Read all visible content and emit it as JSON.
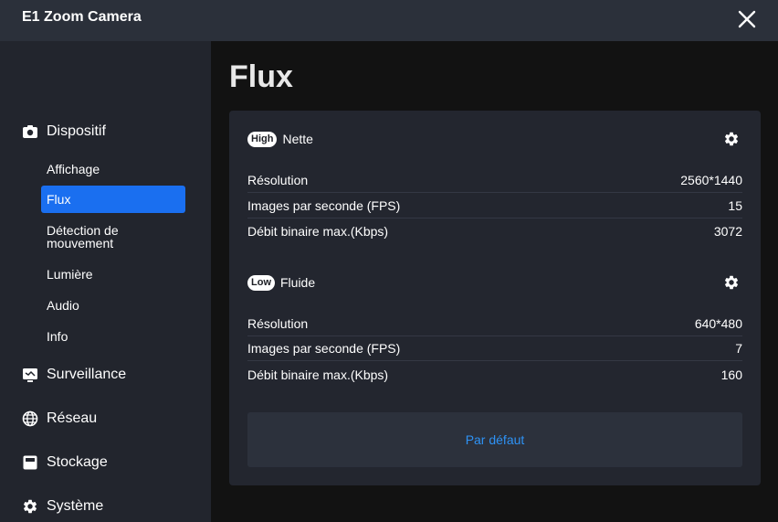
{
  "window": {
    "title": "E1 Zoom Camera"
  },
  "sidebar": {
    "sections": {
      "device": "Dispositif",
      "surveillance": "Surveillance",
      "network": "Réseau",
      "storage": "Stockage",
      "system": "Système"
    },
    "device_items": [
      "Affichage",
      "Flux",
      "Détection de mouvement",
      "Lumière",
      "Audio",
      "Info"
    ],
    "active_item": "Flux"
  },
  "page": {
    "title": "Flux"
  },
  "streams": [
    {
      "badge": "High",
      "name": "Nette",
      "rows": [
        {
          "label": "Résolution",
          "value": "2560*1440"
        },
        {
          "label": "Images par seconde (FPS)",
          "value": "15"
        },
        {
          "label": "Débit binaire max.(Kbps)",
          "value": "3072"
        }
      ]
    },
    {
      "badge": "Low",
      "name": "Fluide",
      "rows": [
        {
          "label": "Résolution",
          "value": "640*480"
        },
        {
          "label": "Images par seconde (FPS)",
          "value": "7"
        },
        {
          "label": "Débit binaire max.(Kbps)",
          "value": "160"
        }
      ]
    }
  ],
  "actions": {
    "default_label": "Par défaut"
  },
  "colors": {
    "accent": "#1a6ff0",
    "link": "#2e92f5",
    "titlebar": "#2b303a",
    "sidebar": "#22252d",
    "card": "#23262f"
  }
}
